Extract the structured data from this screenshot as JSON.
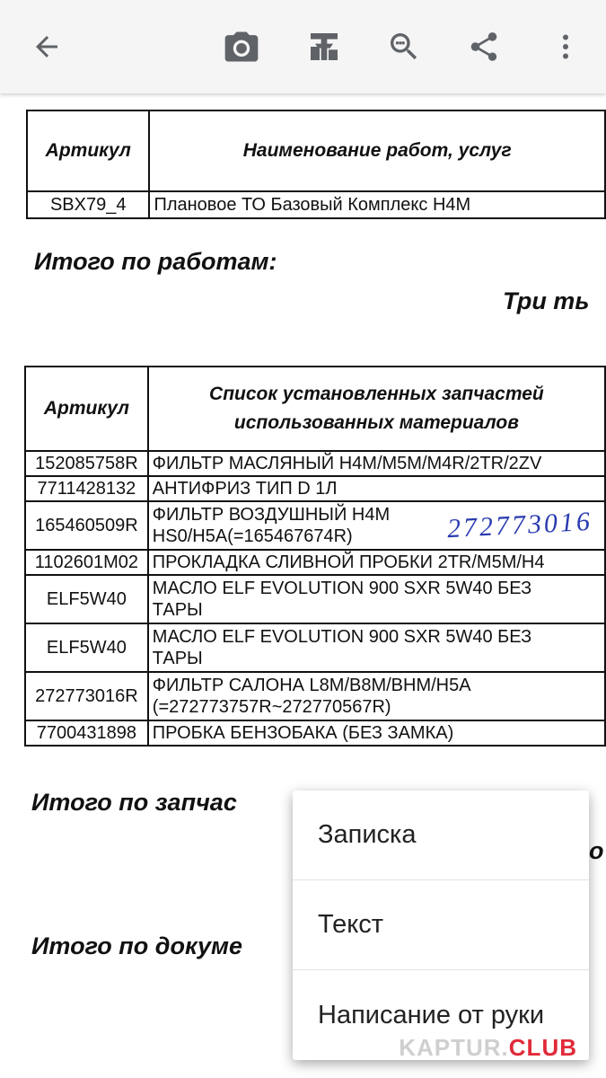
{
  "toolbar": {
    "icons": [
      "back-arrow-icon",
      "camera-icon",
      "stamp-icon",
      "zoom-search-icon",
      "share-icon",
      "more-vert-icon"
    ],
    "icon_color": "#5f6368"
  },
  "document": {
    "works_table": {
      "headers": [
        "Артикул",
        "Наименование работ, услуг"
      ],
      "rows": [
        {
          "code": "SBX79_4",
          "name": "Плановое ТО Базовый Комплекс Н4М"
        }
      ]
    },
    "total_works_label": "Итого по работам:",
    "total_works_value_partial": "Три ть",
    "parts_table": {
      "headers": [
        "Артикул",
        "Список установленных запчастей",
        "использованных материалов"
      ],
      "rows": [
        {
          "code": "152085758R",
          "name": [
            "ФИЛЬТР МАСЛЯНЫЙ H4M/M5M/M4R/2TR/2ZV"
          ]
        },
        {
          "code": "7711428132",
          "name": [
            "АНТИФРИЗ ТИП D 1Л"
          ]
        },
        {
          "code": "165460509R",
          "name": [
            "ФИЛЬТР ВОЗДУШНЫЙ H4M",
            "HS0/H5A(=165467674R)"
          ]
        },
        {
          "code": "1102601M02",
          "name": [
            "ПРОКЛАДКА СЛИВНОЙ ПРОБКИ 2TR/M5M/H4"
          ]
        },
        {
          "code": "ELF5W40",
          "name": [
            "МАСЛО ELF EVOLUTION 900 SXR 5W40 БЕЗ",
            "ТАРЫ"
          ]
        },
        {
          "code": "ELF5W40",
          "name": [
            "МАСЛО ELF EVOLUTION 900 SXR 5W40 БЕЗ",
            "ТАРЫ"
          ]
        },
        {
          "code": "272773016R",
          "name": [
            "ФИЛЬТР САЛОНА L8M/B8M/BHM/H5A",
            "(=272773757R~272770567R)"
          ]
        },
        {
          "code": "7700431898",
          "name": [
            "ПРОБКА БЕНЗОБАКА (БЕЗ ЗАМКА)"
          ]
        }
      ]
    },
    "handwritten_note": "272773016",
    "total_parts_label": "Итого по запчас",
    "total_parts_value_partial": "о",
    "total_doc_label": "Итого по докуме"
  },
  "menu": {
    "items": [
      "Записка",
      "Текст",
      "Написание от руки"
    ]
  },
  "watermark": {
    "part1": "KAPTUR.",
    "part2": "CLUB"
  }
}
